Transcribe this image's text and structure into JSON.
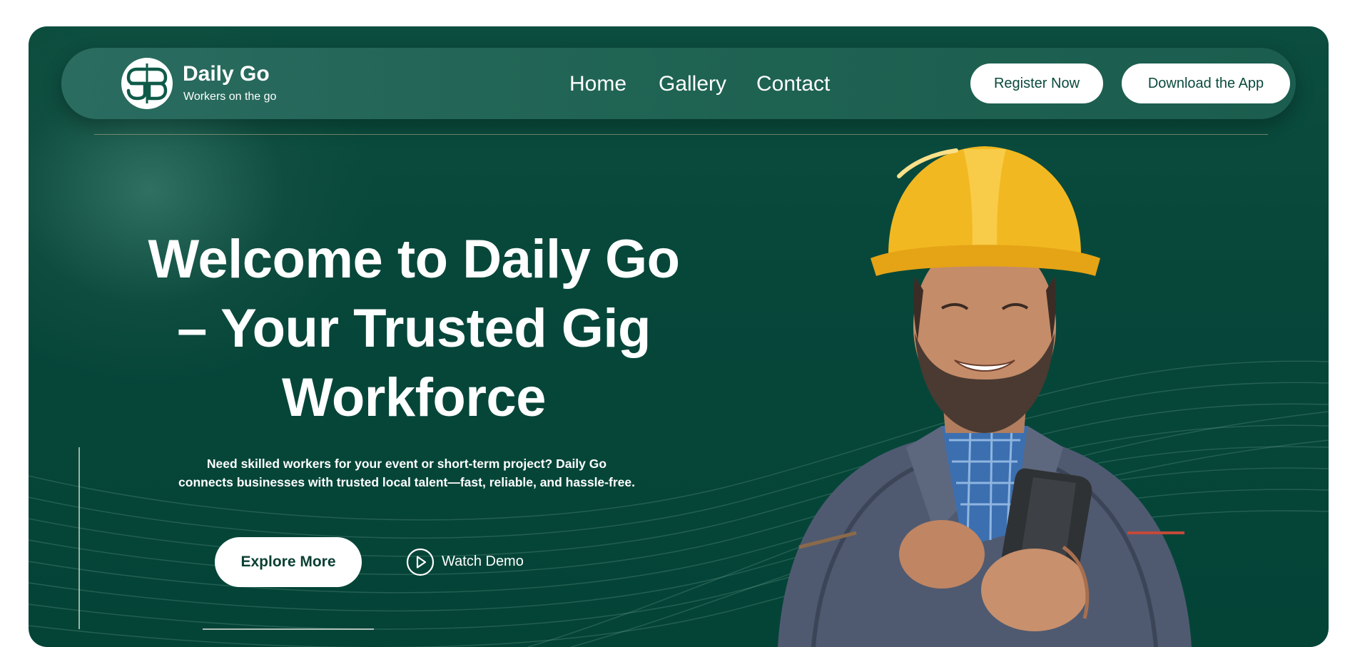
{
  "brand": {
    "name": "Daily Go",
    "tagline": "Workers on the go",
    "logo_icon": "dg-monogram-icon"
  },
  "nav": {
    "links": [
      "Home",
      "Gallery",
      "Contact"
    ],
    "register_label": "Register Now",
    "download_label": "Download the App"
  },
  "hero": {
    "headline_lines": [
      "Welcome to Daily Go",
      "– Your Trusted Gig",
      "Workforce"
    ],
    "subtext_lines": [
      "Need skilled workers for your event or short-term project? Daily Go",
      "connects businesses with trusted local talent—fast, reliable, and hassle-free."
    ],
    "explore_label": "Explore More",
    "watch_label": "Watch Demo",
    "watch_icon": "play-circle-icon",
    "image_subject": "worker-with-hard-hat-and-phone"
  },
  "colors": {
    "background_green": "#06473a",
    "nav_green": "#236656",
    "button_text": "#0a4a3c",
    "helmet_yellow": "#f2b821",
    "white": "#ffffff"
  }
}
